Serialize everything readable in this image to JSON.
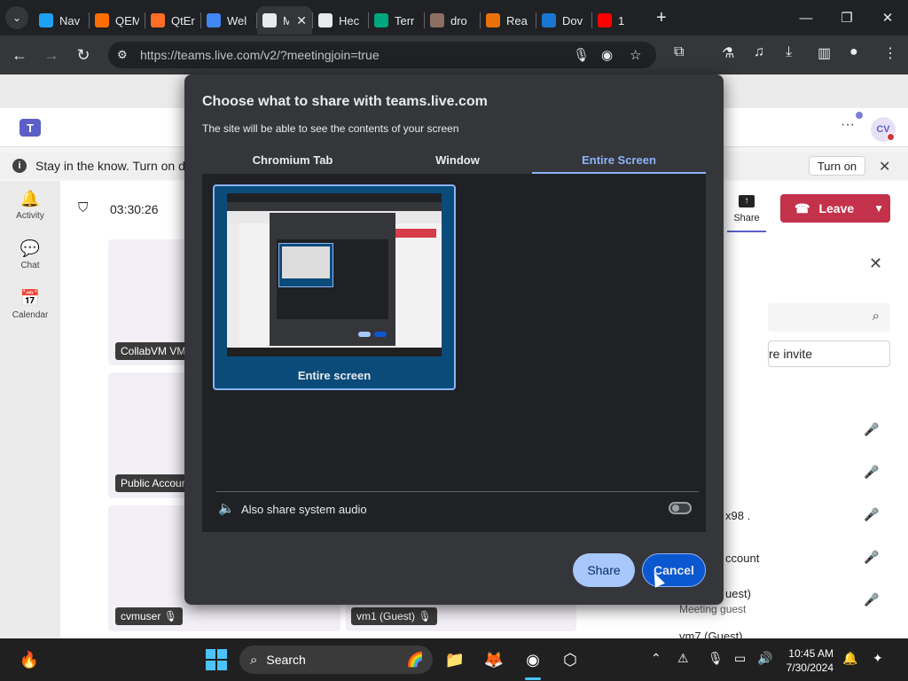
{
  "browser": {
    "tabs": [
      {
        "title": "Nav",
        "color": "#1da1f2"
      },
      {
        "title": "QEM",
        "color": "#ff6d00"
      },
      {
        "title": "QtEr",
        "color": "#fc6d26"
      },
      {
        "title": "Wel",
        "color": "#4285f4"
      },
      {
        "title": "M",
        "color": "#e8eaed",
        "active": true
      },
      {
        "title": "Hec",
        "color": "#e8eaed"
      },
      {
        "title": "Terr",
        "color": "#00a67e"
      },
      {
        "title": "dro",
        "color": "#8d6e63"
      },
      {
        "title": "Rea",
        "color": "#e8710a"
      },
      {
        "title": "Dov",
        "color": "#1976d2"
      },
      {
        "title": "1",
        "color": "#ff0000"
      }
    ],
    "url": "https://teams.live.com/v2/?meetingjoin=true"
  },
  "teams": {
    "avatar_initials": "CV",
    "notification": "Stay in the know. Turn on d",
    "turn_on_label": "Turn on",
    "rail": [
      {
        "label": "Activity",
        "icon": "bell-icon"
      },
      {
        "label": "Chat",
        "icon": "chat-icon"
      },
      {
        "label": "Calendar",
        "icon": "calendar-icon"
      }
    ],
    "timer": "03:30:26",
    "share_label": "Share",
    "leave_label": "Leave",
    "tiles": [
      {
        "label": "CollabVM VM"
      },
      {
        "label": "Public Accour"
      },
      {
        "label": "cvmuser"
      },
      {
        "label": "vm1 (Guest)"
      }
    ],
    "invite_text": "re invite",
    "participants": [
      {
        "name": "x98 ."
      },
      {
        "name": "ccount"
      },
      {
        "name": "uest)",
        "sub": "Meeting guest"
      },
      {
        "name": "vm7 (Guest)"
      }
    ]
  },
  "dialog": {
    "title": "Choose what to share with teams.live.com",
    "subtitle": "The site will be able to see the contents of your screen",
    "tabs": [
      "Chromium Tab",
      "Window",
      "Entire Screen"
    ],
    "active_tab": "Entire Screen",
    "card_label": "Entire screen",
    "audio_label": "Also share system audio",
    "audio_enabled": false,
    "share_button": "Share",
    "cancel_button": "Cancel"
  },
  "taskbar": {
    "search_label": "Search",
    "time": "10:45 AM",
    "date": "7/30/2024"
  }
}
